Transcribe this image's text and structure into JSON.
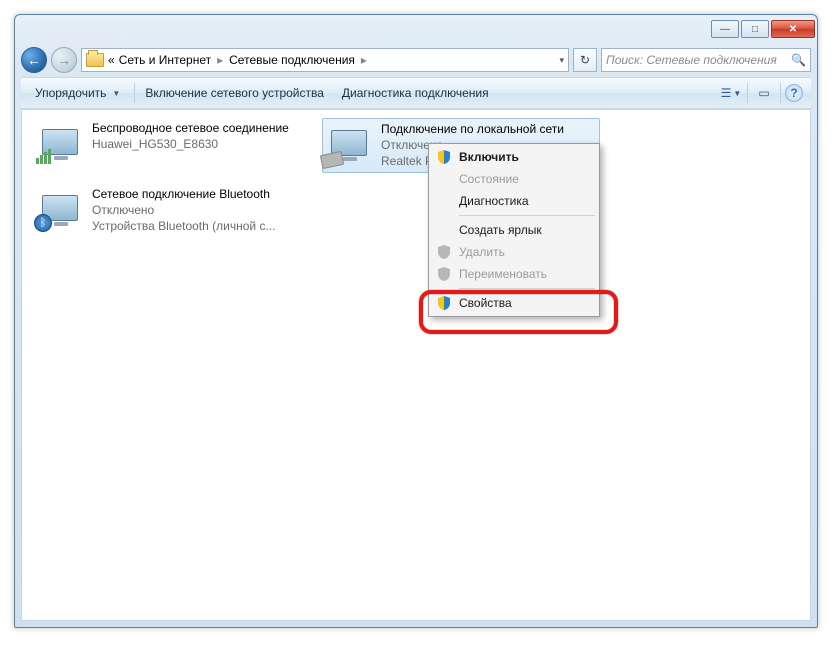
{
  "window": {
    "minimize_glyph": "—",
    "maximize_glyph": "□",
    "close_glyph": "✕"
  },
  "navigation": {
    "back_glyph": "←",
    "forward_glyph": "→",
    "breadcrumb_prefix": "«",
    "breadcrumb1": "Сеть и Интернет",
    "breadcrumb2": "Сетевые подключения",
    "dropdown_glyph": "▾",
    "refresh_glyph": "↻"
  },
  "search": {
    "placeholder": "Поиск: Сетевые подключения",
    "mag_glyph": "🔍"
  },
  "toolbar": {
    "organize": "Упорядочить",
    "enable_device": "Включение сетевого устройства",
    "diagnostics": "Диагностика подключения",
    "view_glyph": "☰",
    "pane_glyph": "▭",
    "help_glyph": "?"
  },
  "connections": [
    {
      "title": "Беспроводное сетевое соединение",
      "sub1": "Huawei_HG530_E8630",
      "sub2": "",
      "type": "wifi"
    },
    {
      "title": "Сетевое подключение Bluetooth",
      "sub1": "Отключено",
      "sub2": "Устройства Bluetooth (личной с...",
      "type": "bt"
    },
    {
      "title": "Подключение по локальной сети",
      "sub1": "Отключено",
      "sub2": "Realtek PCI...",
      "type": "lan"
    }
  ],
  "context_menu": {
    "enable": "Включить",
    "status": "Состояние",
    "diagnose": "Диагностика",
    "shortcut": "Создать ярлык",
    "delete": "Удалить",
    "rename": "Переименовать",
    "properties": "Свойства"
  }
}
